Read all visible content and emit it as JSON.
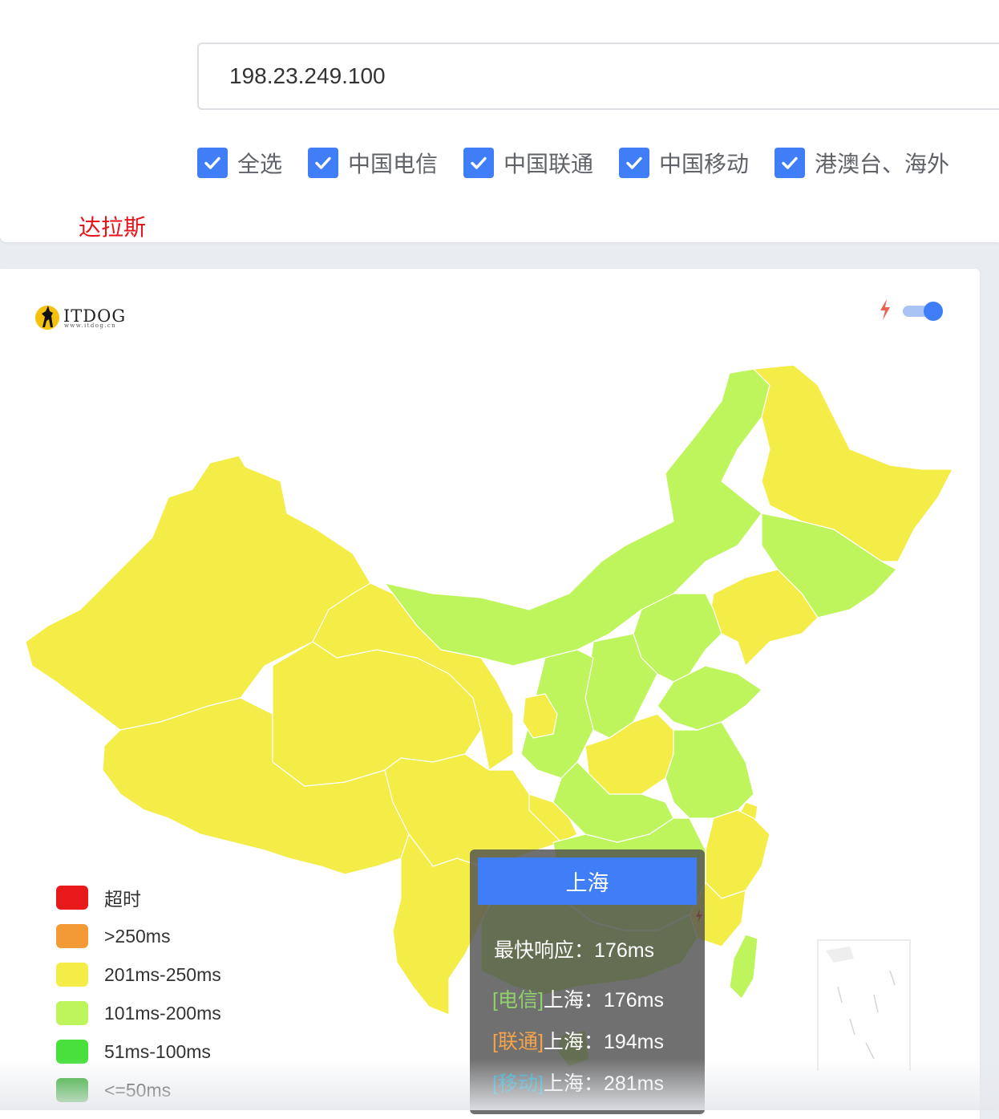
{
  "search": {
    "ip_value": "198.23.249.100"
  },
  "filters": [
    {
      "label": "全选",
      "checked": true
    },
    {
      "label": "中国电信",
      "checked": true
    },
    {
      "label": "中国联通",
      "checked": true
    },
    {
      "label": "中国移动",
      "checked": true
    },
    {
      "label": "港澳台、海外",
      "checked": true
    }
  ],
  "location_label": "达拉斯",
  "logo": {
    "name": "ITDOG",
    "url_text": "www.itdog.cn"
  },
  "controls": {
    "bolt_icon": "lightning-icon",
    "toggle_on": true,
    "accent": "#3f7ef6"
  },
  "legend": [
    {
      "label": "超时",
      "color": "#e8191b"
    },
    {
      "label": ">250ms",
      "color": "#f39a37"
    },
    {
      "label": "201ms-250ms",
      "color": "#f4ec47"
    },
    {
      "label": "101ms-200ms",
      "color": "#bef55c"
    },
    {
      "label": "51ms-100ms",
      "color": "#49e03e"
    },
    {
      "label": "<=50ms",
      "color": "#24a621"
    }
  ],
  "tooltip": {
    "title": "上海",
    "fastest_label": "最快响应：",
    "fastest_value": "176ms",
    "lines": [
      {
        "carrier": "[电信]",
        "carrier_color": "#8fd16a",
        "city": "上海：",
        "value": "176ms"
      },
      {
        "carrier": "[联通]",
        "carrier_color": "#f5a34a",
        "city": "上海：",
        "value": "194ms"
      },
      {
        "carrier": "[移动]",
        "carrier_color": "#27a6c9",
        "city": "上海：",
        "value": "281ms"
      }
    ]
  }
}
